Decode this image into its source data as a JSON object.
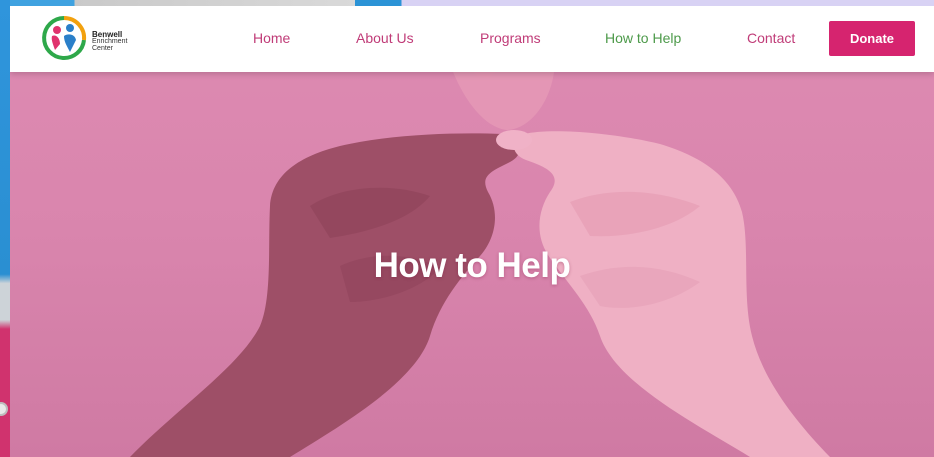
{
  "logo": {
    "name": "Benwell",
    "line2": "Enrichment",
    "line3": "Center"
  },
  "nav": {
    "items": [
      {
        "label": "Home"
      },
      {
        "label": "About Us"
      },
      {
        "label": "Programs"
      },
      {
        "label": "How to Help",
        "active": true
      },
      {
        "label": "Contact"
      }
    ],
    "donate_label": "Donate"
  },
  "hero": {
    "title": "How to Help",
    "image": "two-hands-holding-heart"
  },
  "colors": {
    "brand_pink": "#d6246f",
    "nav_link": "#c03c78",
    "nav_active": "#4d9a4a",
    "hero_overlay": "#de8bb2"
  }
}
